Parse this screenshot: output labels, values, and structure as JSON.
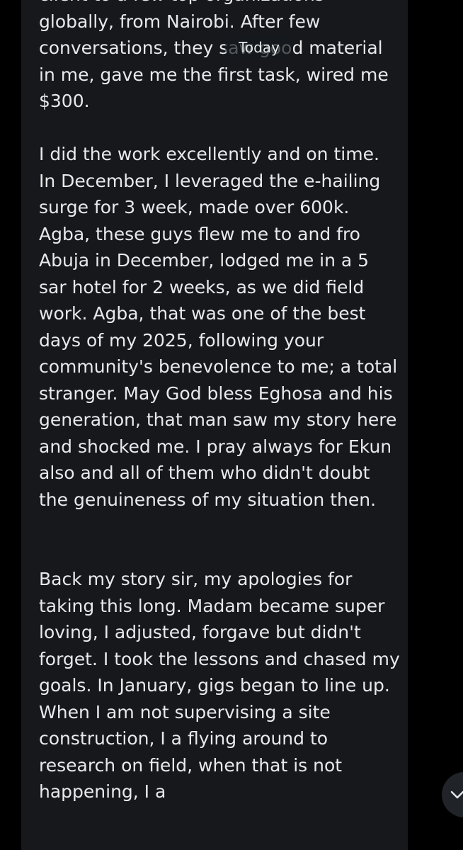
{
  "chat": {
    "date_separator": "Today",
    "message": {
      "text": "client to a few top organizations globally, from Nairobi. After few conversations, they saw good material in me, gave me the first task, wired me $300.\n\nI did the work excellently and on time. In December, I leveraged the e-hailing surge for 3 week, made over 600k. Agba, these guys flew me to and fro Abuja in December, lodged me in a 5 sar hotel for 2 weeks, as we did field work. Agba, that was one of the best days of my 2025, following your community's benevolence to me; a total stranger. May God bless Eghosa and his generation, that man saw my story here and shocked me. I pray always for Ekun also and all of them who didn't doubt the genuineness of my situation then.\n\n\nBack my story sir, my apologies for taking this long. Madam became super loving, I adjusted, forgave but didn't forget. I took the lessons and chased my goals. In January, gigs began to line up. When I am not supervising a site construction, I a flying around to research on field, when that is not happening, I a"
    }
  },
  "controls": {
    "scroll_down_icon": "chevron-down-icon"
  },
  "colors": {
    "background": "#000000",
    "bubble": "#16181c",
    "text": "#e7e9ea",
    "button": "#202327"
  }
}
